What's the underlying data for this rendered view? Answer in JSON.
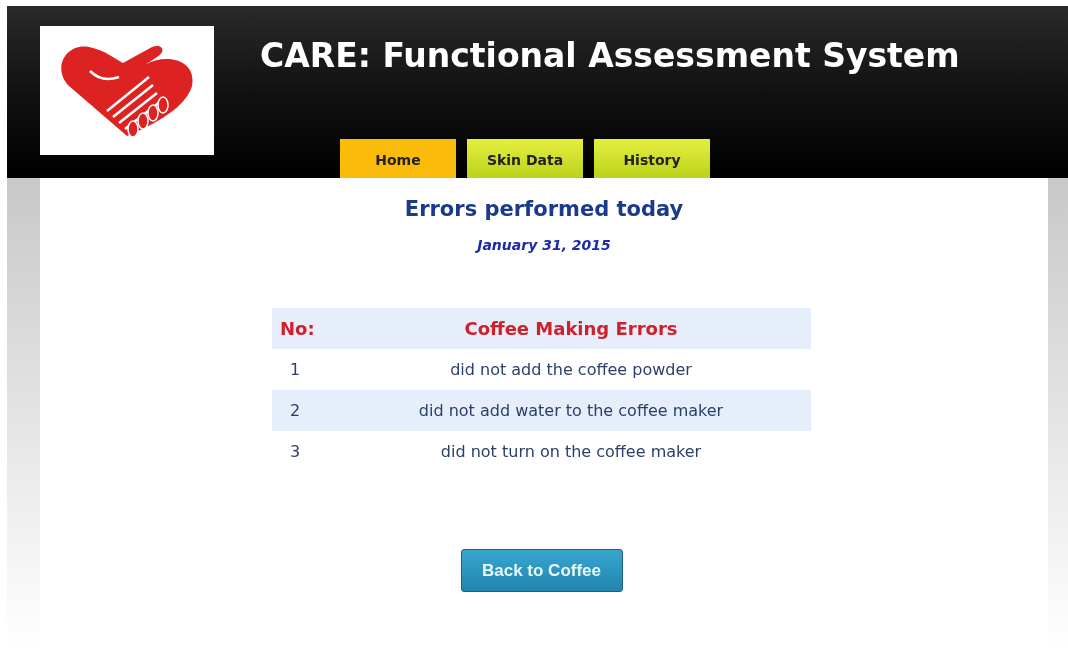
{
  "header": {
    "title": "CARE: Functional Assessment System"
  },
  "tabs": [
    {
      "label": "Home",
      "selected": true
    },
    {
      "label": "Skin Data",
      "selected": false
    },
    {
      "label": "History",
      "selected": false
    }
  ],
  "heading": "Errors performed today",
  "date": "January 31, 2015",
  "table": {
    "columns": [
      "No:",
      "Coffee Making Errors"
    ],
    "rows": [
      [
        "1",
        "did not add the coffee powder"
      ],
      [
        "2",
        "did not add water to the coffee maker"
      ],
      [
        "3",
        "did not turn on the coffee maker"
      ]
    ]
  },
  "button": "Back to Coffee"
}
